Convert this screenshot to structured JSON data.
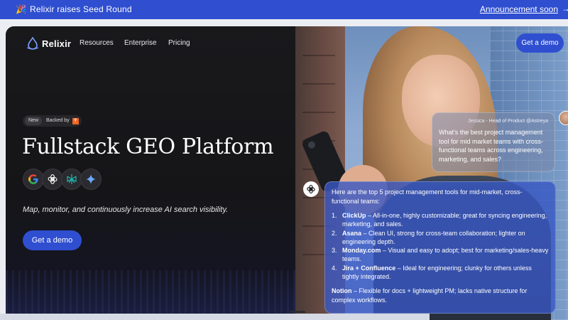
{
  "announcement": {
    "party_icon": "🎉",
    "message": "Relixir raises Seed Round",
    "link": "Announcement soon",
    "arrow": "→"
  },
  "nav": {
    "brand": "Relixir",
    "logo_icon": "relixir-drop-logo",
    "links": [
      "Resources",
      "Enterprise",
      "Pricing"
    ],
    "cta": "Get a demo"
  },
  "hero": {
    "badge_new": "New",
    "badge_backed": "Backed by",
    "badge_yc": "Y",
    "title": "Fullstack GEO Platform",
    "ai_icons": [
      "google-icon",
      "openai-icon",
      "perplexity-icon",
      "gemini-icon"
    ],
    "subtitle": "Map, monitor, and continuously increase AI search visibility.",
    "cta": "Get a demo"
  },
  "question_card": {
    "author": "Jessica - Head of Product @Astreya",
    "question": "What's the best project management tool for mid market teams with cross-functional teams across engineering, marketing, and sales?"
  },
  "answer_card": {
    "intro": "Here are the top 5 project management tools for mid-market, cross-functional teams:",
    "items": [
      {
        "num": "1.",
        "name": "ClickUp",
        "desc": " – All-in-one, highly customizable; great for syncing engineering, marketing, and sales."
      },
      {
        "num": "2.",
        "name": "Asana",
        "desc": " – Clean UI, strong for cross-team collaboration; lighter on engineering depth."
      },
      {
        "num": "3.",
        "name": "Monday.com",
        "desc": " – Visual and easy to adopt; best for marketing/sales-heavy teams."
      },
      {
        "num": "4.",
        "name": "Jira + Confluence",
        "desc": " – Ideal for engineering; clunky for others unless tightly integrated."
      }
    ],
    "notion_name": "Notion",
    "notion_desc": " – Flexible for docs + lightweight PM; lacks native structure for complex workflows."
  },
  "colors": {
    "accent": "#2f4fd0",
    "hero_bg": "#141417"
  }
}
